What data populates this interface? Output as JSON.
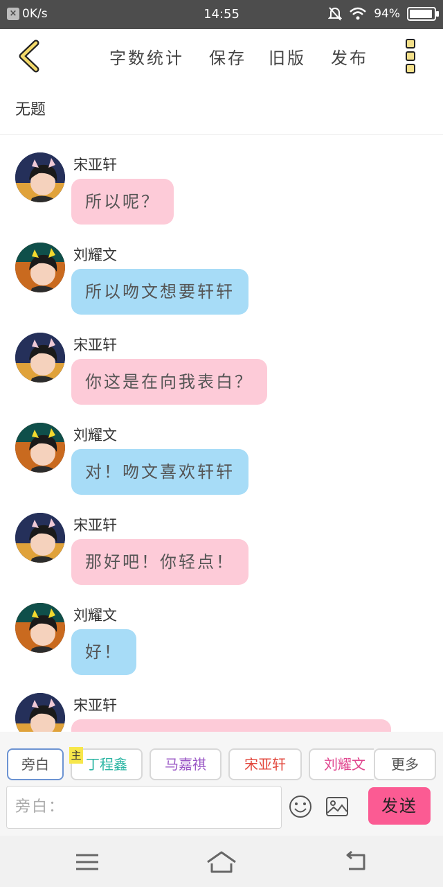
{
  "status_bar": {
    "net_speed": "0K/s",
    "time": "14:55",
    "battery": "94%",
    "battery_level": 0.94
  },
  "header": {
    "links": [
      "字数统计",
      "保存",
      "旧版",
      "发布"
    ]
  },
  "document": {
    "title": "无题"
  },
  "messages": [
    {
      "sender": "宋亚轩",
      "text": "所以呢？",
      "style": "pink"
    },
    {
      "sender": "刘耀文",
      "text": "所以吻文想要轩轩",
      "style": "blue"
    },
    {
      "sender": "宋亚轩",
      "text": "你这是在向我表白？",
      "style": "pink"
    },
    {
      "sender": "刘耀文",
      "text": "对！吻文喜欢轩轩",
      "style": "blue"
    },
    {
      "sender": "宋亚轩",
      "text": "那好吧！你轻点！",
      "style": "pink"
    },
    {
      "sender": "刘耀文",
      "text": "好！",
      "style": "blue"
    },
    {
      "sender": "宋亚轩",
      "text": "",
      "style": "pink"
    }
  ],
  "roles": {
    "main_tag": "主",
    "chips": [
      {
        "label": "旁白",
        "color": "#555555"
      },
      {
        "label": "丁程鑫",
        "color": "#2bb5a3"
      },
      {
        "label": "马嘉祺",
        "color": "#9b59c6"
      },
      {
        "label": "宋亚轩",
        "color": "#e2463b"
      },
      {
        "label": "刘耀文",
        "color": "#e0458e"
      },
      {
        "label": "更多",
        "color": "#555555"
      }
    ]
  },
  "composer": {
    "placeholder": "旁白：",
    "send_label": "发送"
  },
  "colors": {
    "pink_bubble": "#fdcbd8",
    "blue_bubble": "#a7dcf7",
    "send_button": "#fb5b93",
    "back_arrow": "#f3d96a"
  }
}
